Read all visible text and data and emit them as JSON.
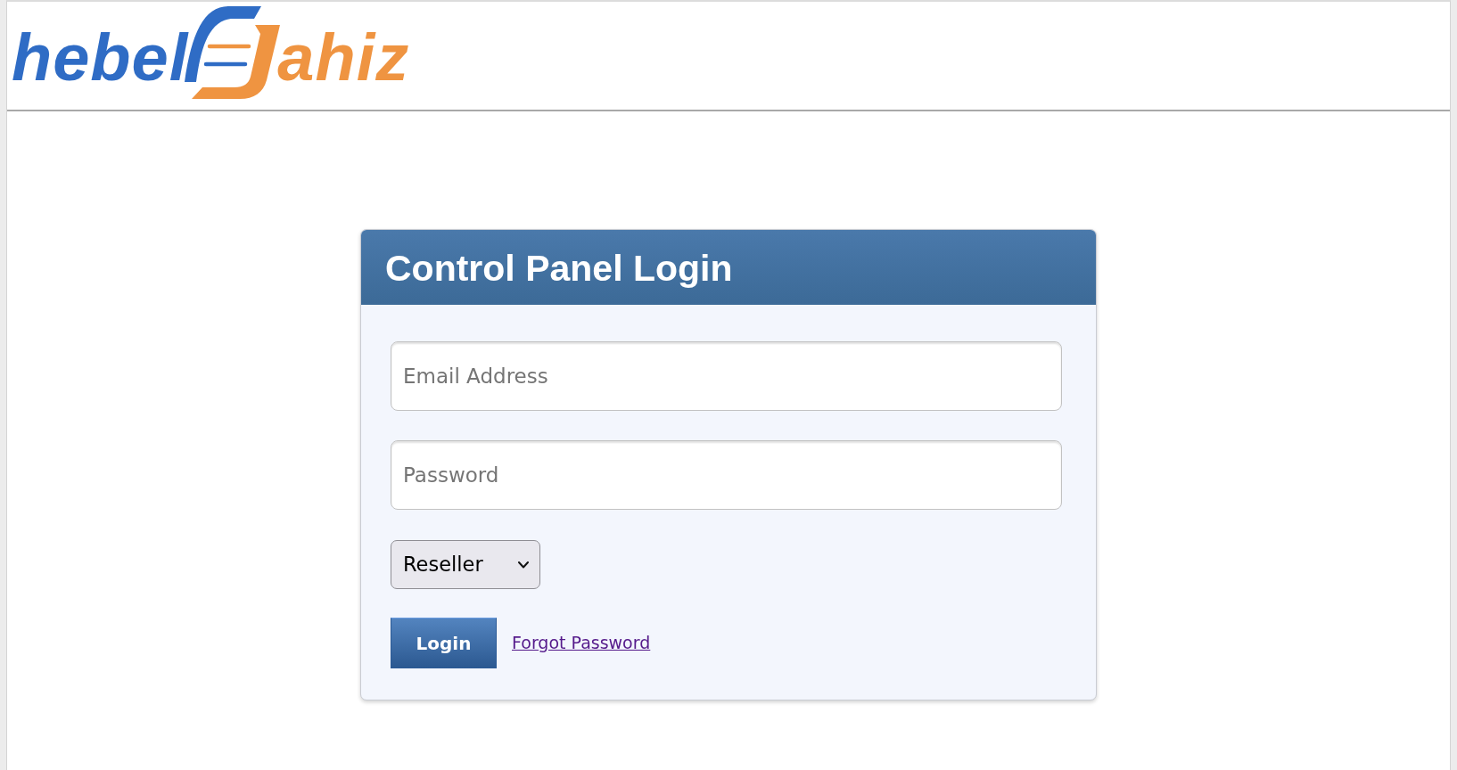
{
  "header": {
    "logo": {
      "text_start": "hebel",
      "text_end": "ahiz"
    }
  },
  "login_panel": {
    "title": "Control Panel Login",
    "email_field": {
      "placeholder": "Email Address"
    },
    "password_field": {
      "placeholder": "Password"
    },
    "dropdown": {
      "value": "Reseller"
    },
    "login_button": {
      "label": "Login"
    },
    "forgot_password_link": {
      "label": "Forgot Password"
    }
  }
}
